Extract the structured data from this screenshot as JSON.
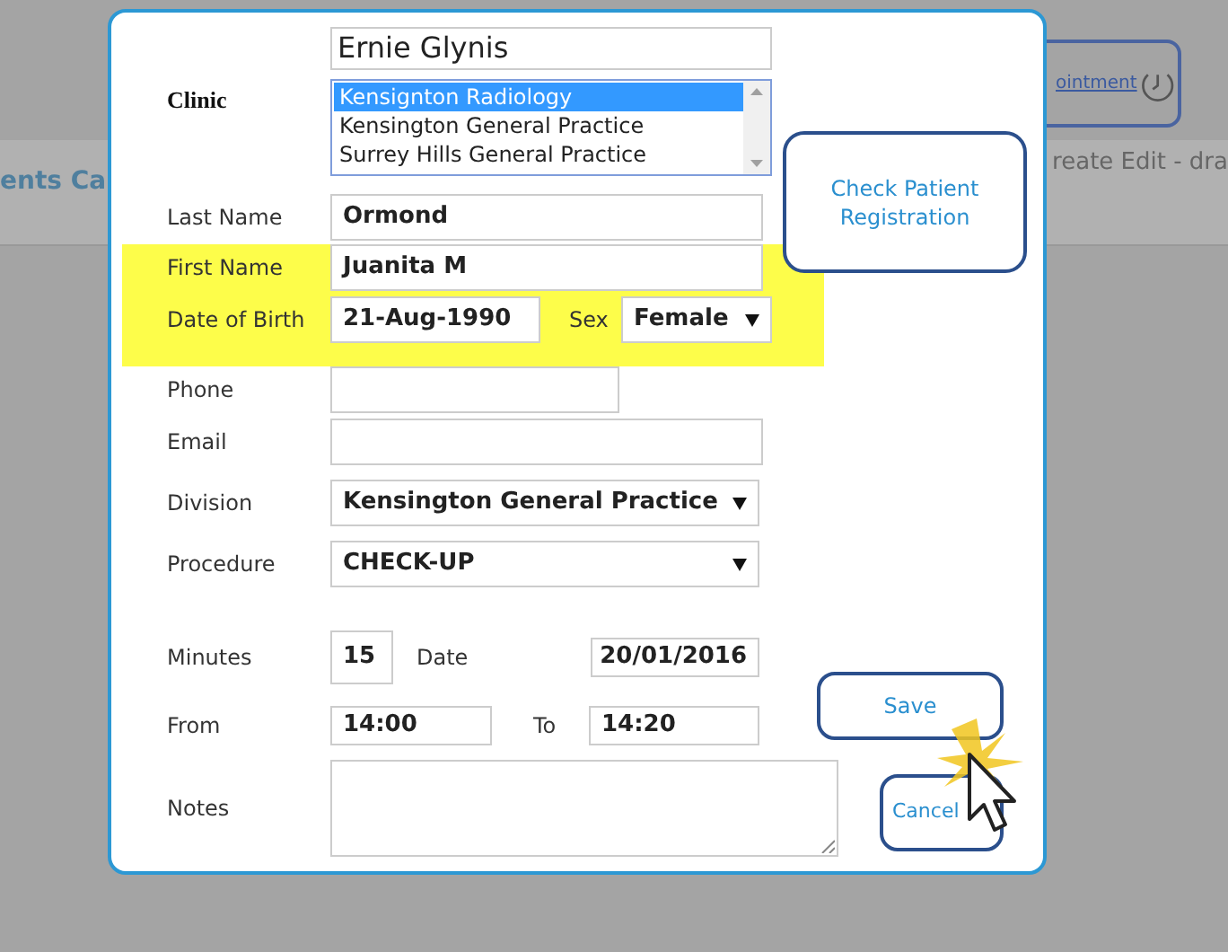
{
  "background": {
    "heading": "ents Ca",
    "breadcrumb": "reate Edit - dra",
    "button": "ointment"
  },
  "patient_name": {
    "value": "Ernie Glynis"
  },
  "clinic": {
    "label": "Clinic",
    "options": [
      {
        "label": "Kensignton Radiology",
        "selected": true
      },
      {
        "label": "Kensington General Practice",
        "selected": false
      },
      {
        "label": "Surrey Hills General Practice",
        "selected": false
      }
    ]
  },
  "rows": [
    {
      "kind": "text",
      "label": "Last Name",
      "value": "Ormond",
      "highlighted": false
    },
    {
      "kind": "text",
      "label": "First Name",
      "value": "Juanita M",
      "highlighted": true
    },
    {
      "kind": "dob",
      "label": "Date of Birth",
      "value": "21-Aug-1990",
      "sex_label": "Sex",
      "sex": "Female",
      "highlighted": true
    },
    {
      "kind": "short",
      "label": "Phone",
      "highlighted": false
    },
    {
      "kind": "text",
      "label": "Email",
      "highlighted": false
    },
    {
      "kind": "select",
      "label": "Division",
      "value": "Kensington General Practice",
      "highlighted": false
    },
    {
      "kind": "select",
      "label": "Procedure",
      "value": "CHECK-UP",
      "highlighted": false
    },
    {
      "kind": "minutes",
      "label": "Minutes",
      "value": "15",
      "date_label": "Date",
      "date": "20/01/2016",
      "highlighted": false
    },
    {
      "kind": "times",
      "label": "From",
      "value": "14:00",
      "to_label": "To",
      "to": "14:20",
      "highlighted": false
    },
    {
      "kind": "notes",
      "label": "Notes",
      "highlighted": false
    }
  ],
  "buttons": [
    {
      "label": "Check Patient Registration"
    },
    {
      "label": "Save"
    },
    {
      "label": "Cancel"
    }
  ]
}
